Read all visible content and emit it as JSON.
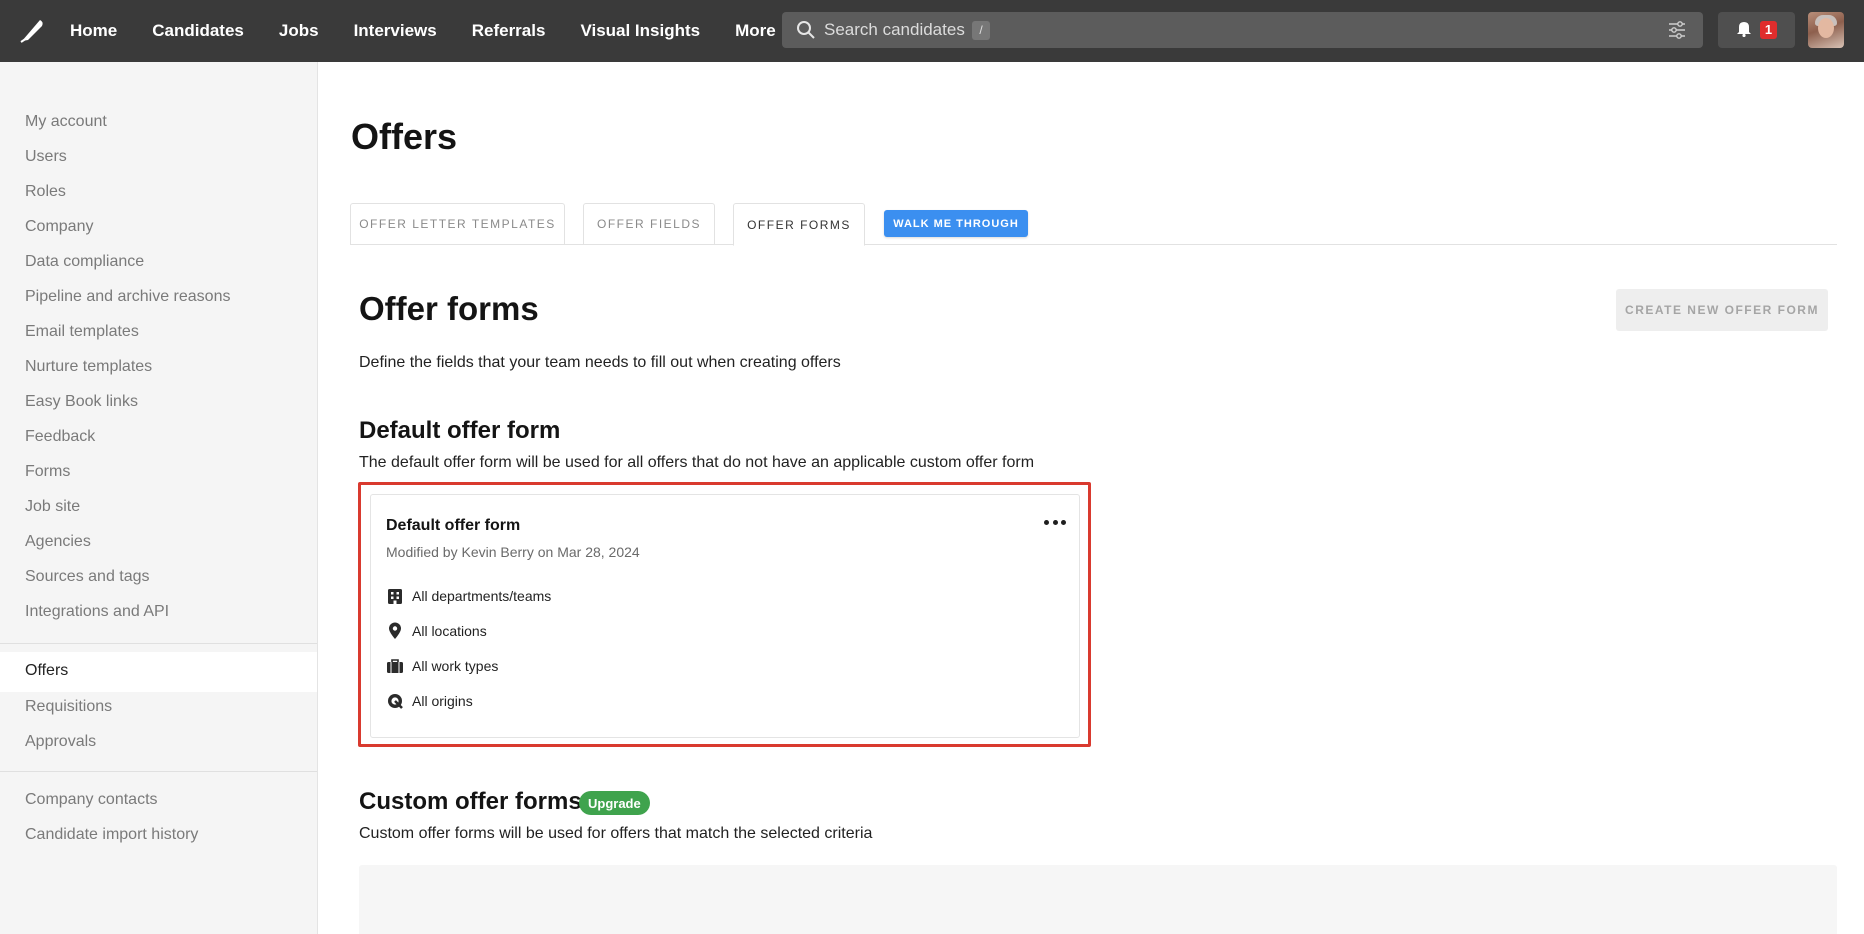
{
  "nav": {
    "items": [
      "Home",
      "Candidates",
      "Jobs",
      "Interviews",
      "Referrals",
      "Visual Insights",
      "More"
    ],
    "search_placeholder": "Search candidates",
    "search_shortcut": "/",
    "notification_count": "1",
    "icons": {
      "logo": "feather-logo-icon",
      "search": "search-icon",
      "filter": "sliders-icon",
      "bell": "bell-icon",
      "more": "chevron-down-icon"
    }
  },
  "sidebar": {
    "group1": [
      "My account",
      "Users",
      "Roles",
      "Company",
      "Data compliance",
      "Pipeline and archive reasons",
      "Email templates",
      "Nurture templates",
      "Easy Book links",
      "Feedback",
      "Forms",
      "Job site",
      "Agencies",
      "Sources and tags",
      "Integrations and API"
    ],
    "group2": [
      "Offers",
      "Requisitions",
      "Approvals"
    ],
    "group3": [
      "Company contacts",
      "Candidate import history"
    ],
    "active": "Offers"
  },
  "main": {
    "page_title": "Offers",
    "tabs": [
      {
        "label": "Offer letter templates",
        "active": false
      },
      {
        "label": "Offer fields",
        "active": false
      },
      {
        "label": "Offer forms",
        "active": true
      }
    ],
    "walk_button": "Walk me through",
    "section_title": "Offer forms",
    "create_button": "Create new offer form",
    "section_desc": "Define the fields that your team needs to fill out when creating offers",
    "default": {
      "title": "Default offer form",
      "desc": "The default offer form will be used for all offers that do not have an applicable custom offer form",
      "card": {
        "title": "Default offer form",
        "meta": "Modified by Kevin Berry on Mar 28, 2024",
        "criteria": [
          {
            "icon": "building-icon",
            "label": "All departments/teams"
          },
          {
            "icon": "location-pin-icon",
            "label": "All locations"
          },
          {
            "icon": "briefcase-icon",
            "label": "All work types"
          },
          {
            "icon": "origin-icon",
            "label": "All origins"
          }
        ]
      }
    },
    "custom": {
      "title": "Custom offer forms",
      "badge": "Upgrade",
      "desc": "Custom offer forms will be used for offers that match the selected criteria"
    }
  },
  "colors": {
    "topbar": "#3a3a3a",
    "accent_blue": "#3b8ff0",
    "highlight_red": "#d93a2f",
    "upgrade_green": "#3fa34d",
    "badge_red": "#e02d2d"
  }
}
